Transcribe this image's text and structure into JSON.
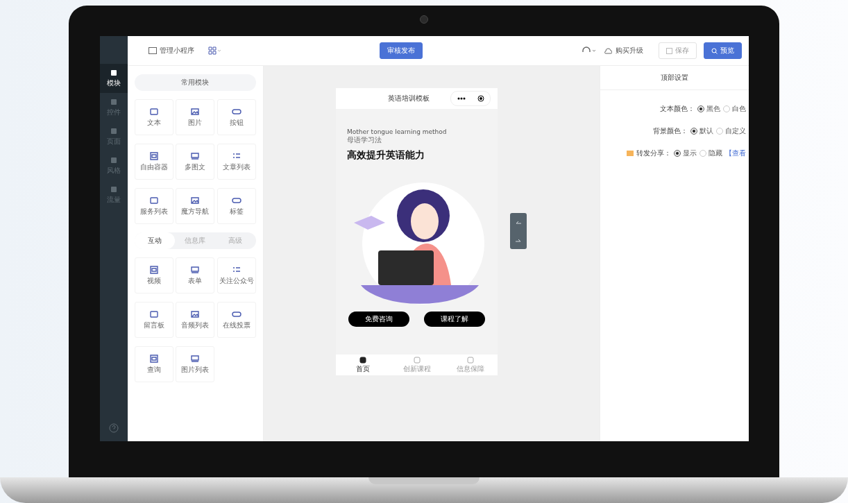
{
  "topbar": {
    "manage": "管理小程序",
    "publish": "审核发布",
    "upgrade": "购买升级",
    "save": "保存",
    "preview": "预览"
  },
  "rail": [
    {
      "label": "模块",
      "selected": true
    },
    {
      "label": "控件",
      "selected": false
    },
    {
      "label": "页面",
      "selected": false
    },
    {
      "label": "风格",
      "selected": false
    },
    {
      "label": "流量",
      "selected": false
    }
  ],
  "common_title": "常用模块",
  "common_modules": [
    {
      "label": "文本"
    },
    {
      "label": "图片"
    },
    {
      "label": "按钮"
    },
    {
      "label": "自由容器"
    },
    {
      "label": "多图文"
    },
    {
      "label": "文章列表"
    },
    {
      "label": "服务列表"
    },
    {
      "label": "魔方导航"
    },
    {
      "label": "标签"
    }
  ],
  "module_tabs": [
    {
      "label": "互动",
      "selected": true
    },
    {
      "label": "信息库",
      "selected": false
    },
    {
      "label": "高级",
      "selected": false
    }
  ],
  "interactive_modules": [
    {
      "label": "视频"
    },
    {
      "label": "表单"
    },
    {
      "label": "关注公众号"
    },
    {
      "label": "留言板"
    },
    {
      "label": "音频列表"
    },
    {
      "label": "在线投票"
    },
    {
      "label": "查询"
    },
    {
      "label": "图片列表"
    }
  ],
  "phone": {
    "title": "英语培训模板",
    "subtitle_en": "Mother tongue learning method",
    "subtitle_zh": "母语学习法",
    "headline": "高效提升英语能力",
    "buttons": [
      "免费咨询",
      "课程了解"
    ],
    "tabbar": [
      {
        "label": "首页",
        "selected": true
      },
      {
        "label": "创新课程",
        "selected": false
      },
      {
        "label": "信息保障",
        "selected": false
      }
    ]
  },
  "settings": {
    "title": "顶部设置",
    "rows": [
      {
        "label": "文本颜色：",
        "options": [
          {
            "label": "黑色",
            "selected": true
          },
          {
            "label": "白色",
            "selected": false
          }
        ]
      },
      {
        "label": "背景颜色：",
        "options": [
          {
            "label": "默认",
            "selected": true
          },
          {
            "label": "自定义",
            "selected": false
          }
        ]
      },
      {
        "label": "转发分享：",
        "badge": true,
        "options": [
          {
            "label": "显示",
            "selected": true
          },
          {
            "label": "隐藏",
            "selected": false
          }
        ],
        "link": "【查看"
      }
    ]
  }
}
